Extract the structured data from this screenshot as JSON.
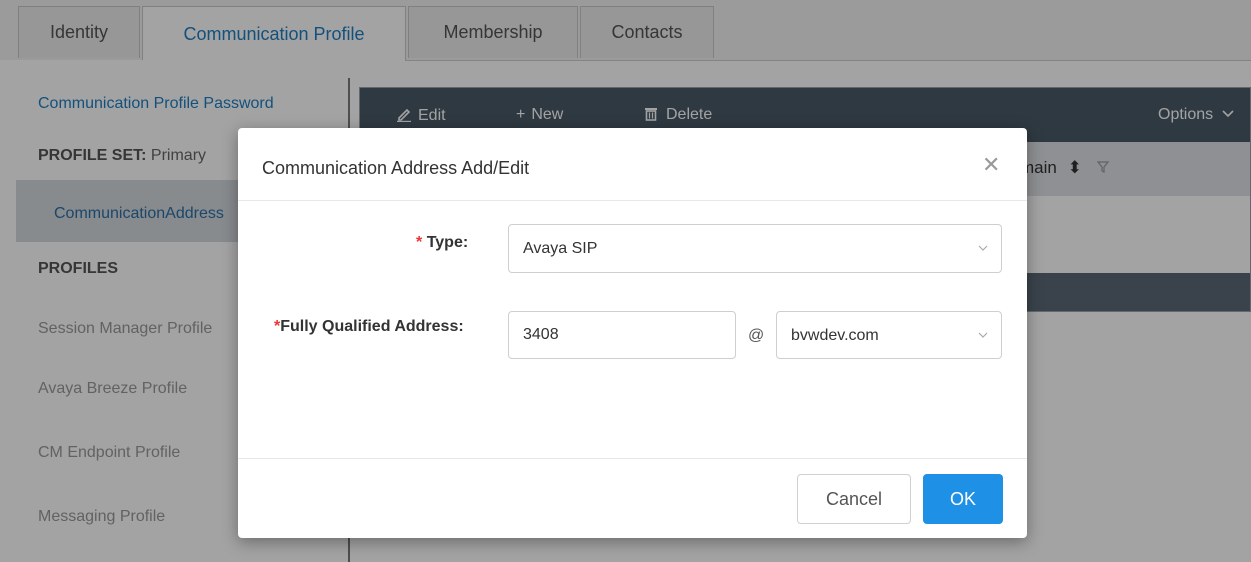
{
  "tabs": [
    {
      "label": "Identity"
    },
    {
      "label": "Communication Profile"
    },
    {
      "label": "Membership"
    },
    {
      "label": "Contacts"
    }
  ],
  "leftnav": {
    "password_link": "Communication Profile Password",
    "profile_set_label": "PROFILE SET:",
    "profile_set_value": "Primary",
    "selected_item": "CommunicationAddress",
    "profiles_heading": "PROFILES",
    "items": [
      {
        "label": "Session Manager Profile"
      },
      {
        "label": "Avaya Breeze Profile"
      },
      {
        "label": "CM Endpoint Profile"
      },
      {
        "label": "Messaging Profile"
      }
    ]
  },
  "toolbar": {
    "edit_label": "Edit",
    "new_label": "New",
    "delete_label": "Delete",
    "options_label": "Options"
  },
  "table": {
    "domain_header": "main"
  },
  "modal": {
    "title": "Communication Address Add/Edit",
    "type_label": "Type",
    "type_value": "Avaya SIP",
    "fqa_label": "Fully Qualified Address",
    "fqa_value": "3408",
    "at_sign": "@",
    "domain_value": "bvwdev.com",
    "cancel_label": "Cancel",
    "ok_label": "OK"
  },
  "colors": {
    "accent": "#1f7fc4",
    "toolbar": "#4a5967",
    "ok_button": "#1e90e6",
    "required": "#e33333"
  }
}
